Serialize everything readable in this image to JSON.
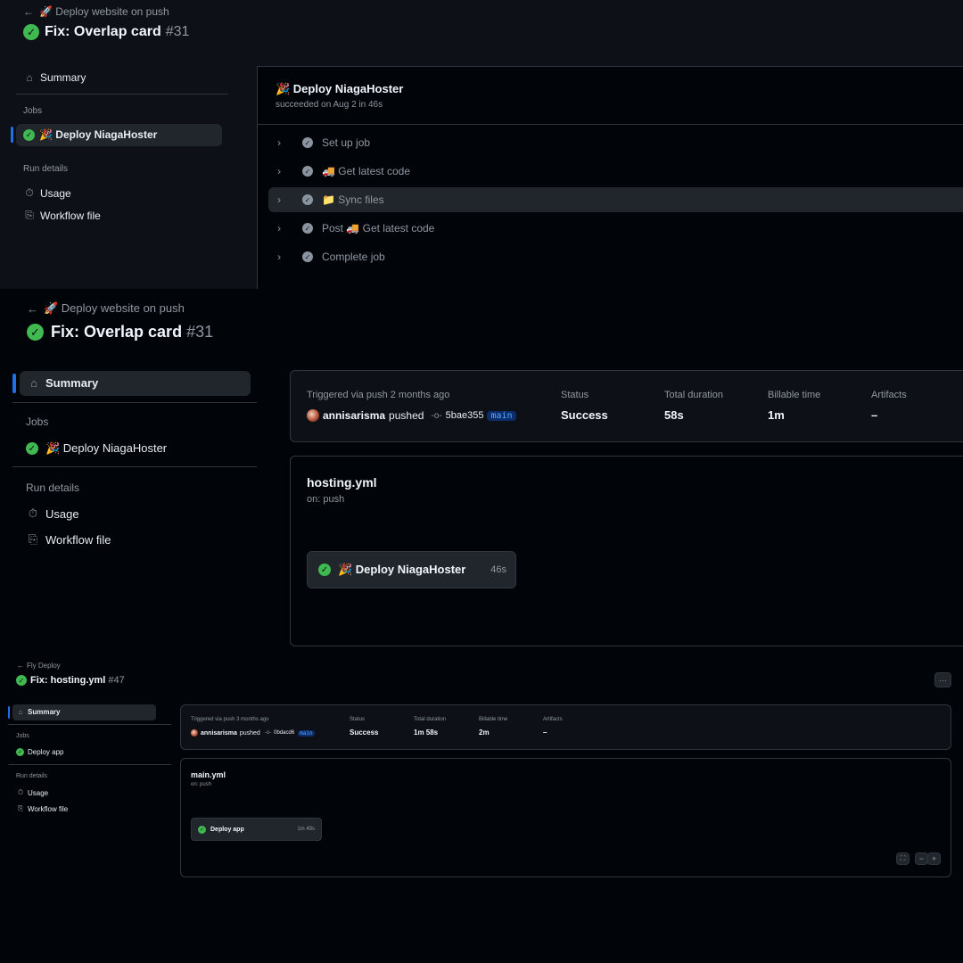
{
  "colors": {
    "bg": "#0d1117",
    "success": "#3fb950",
    "accent": "#1f6feb",
    "muted": "#9198a1",
    "border": "#30363d"
  },
  "p1": {
    "workflow_name": "🚀 Deploy website on push",
    "run_title": "Fix: Overlap card",
    "run_number": "#31",
    "sidebar": {
      "summary": "Summary",
      "jobs_heading": "Jobs",
      "job": "🎉 Deploy NiagaHoster",
      "run_details_heading": "Run details",
      "usage": "Usage",
      "workflow_file": "Workflow file"
    },
    "job_panel": {
      "title": "🎉 Deploy NiagaHoster",
      "subtitle": "succeeded on Aug 2 in 46s",
      "steps": [
        "Set up job",
        "🚚 Get latest code",
        "📁 Sync files",
        "Post 🚚 Get latest code",
        "Complete job"
      ]
    }
  },
  "p2": {
    "workflow_name": "🚀 Deploy website on push",
    "run_title": "Fix: Overlap card",
    "run_number": "#31",
    "sidebar": {
      "summary": "Summary",
      "jobs_heading": "Jobs",
      "job": "🎉 Deploy NiagaHoster",
      "run_details_heading": "Run details",
      "usage": "Usage",
      "workflow_file": "Workflow file"
    },
    "summary": {
      "triggered": "Triggered via push 2 months ago",
      "user": "annisarisma",
      "pushed": "pushed",
      "commit": "5bae355",
      "branch": "main",
      "status_label": "Status",
      "status_value": "Success",
      "duration_label": "Total duration",
      "duration_value": "58s",
      "billable_label": "Billable time",
      "billable_value": "1m",
      "artifacts_label": "Artifacts",
      "artifacts_value": "–"
    },
    "graph": {
      "file": "hosting.yml",
      "trigger": "on: push",
      "job": "🎉 Deploy NiagaHoster",
      "job_duration": "46s"
    }
  },
  "p3": {
    "workflow_name": "Fly Deploy",
    "run_title": "Fix: hosting.yml",
    "run_number": "#47",
    "sidebar": {
      "summary": "Summary",
      "jobs_heading": "Jobs",
      "job": "Deploy app",
      "run_details_heading": "Run details",
      "usage": "Usage",
      "workflow_file": "Workflow file"
    },
    "summary": {
      "triggered": "Triggered via push 3 months ago",
      "user": "annisarisma",
      "pushed": "pushed",
      "commit": "0bdacd6",
      "branch": "main",
      "status_label": "Status",
      "status_value": "Success",
      "duration_label": "Total duration",
      "duration_value": "1m 58s",
      "billable_label": "Billable time",
      "billable_value": "2m",
      "artifacts_label": "Artifacts",
      "artifacts_value": "–"
    },
    "graph": {
      "file": "main.yml",
      "trigger": "on: push",
      "job": "Deploy app",
      "job_duration": "1m 49s"
    },
    "more_label": "···",
    "zoom_out": "−",
    "zoom_in": "+"
  }
}
